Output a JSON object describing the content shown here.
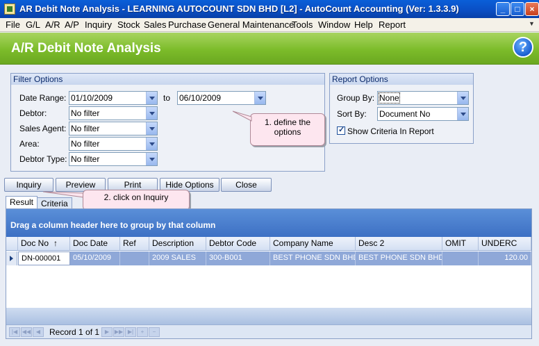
{
  "window": {
    "title": "AR Debit Note Analysis - LEARNING AUTOCOUNT SDN BHD [L2] - AutoCount Accounting (Ver: 1.3.3.9)",
    "minimize": "_",
    "maximize": "□",
    "close": "×"
  },
  "menu": [
    "File",
    "G/L",
    "A/R",
    "A/P",
    "Inquiry",
    "Stock",
    "Sales",
    "Purchase",
    "General Maintenance",
    "Tools",
    "Window",
    "Help",
    "Report"
  ],
  "header": {
    "title": "A/R Debit Note Analysis",
    "help": "?"
  },
  "filter": {
    "title": "Filter Options",
    "date_range_label": "Date Range:",
    "date_from": "01/10/2009",
    "to_label": "to",
    "date_to": "06/10/2009",
    "debtor_label": "Debtor:",
    "debtor_value": "No filter",
    "agent_label": "Sales Agent:",
    "agent_value": "No filter",
    "area_label": "Area:",
    "area_value": "No filter",
    "type_label": "Debtor Type:",
    "type_value": "No filter"
  },
  "report": {
    "title": "Report Options",
    "group_label": "Group By:",
    "group_value": "None",
    "sort_label": "Sort By:",
    "sort_value": "Document No",
    "criteria_label": "Show Criteria In Report"
  },
  "callouts": {
    "define_line1": "1. define the",
    "define_line2": "options",
    "inquiry": "2. click on Inquiry"
  },
  "buttons": {
    "inquiry": "Inquiry",
    "preview": "Preview",
    "print": "Print",
    "hide_options": "Hide Options",
    "close": "Close"
  },
  "tabs": {
    "result": "Result",
    "criteria": "Criteria"
  },
  "grid": {
    "group_panel": "Drag a column header here to group by that column",
    "columns": [
      "Doc No",
      "Doc Date",
      "Ref",
      "Description",
      "Debtor Code",
      "Company Name",
      "Desc 2",
      "OMIT",
      "UNDERC"
    ],
    "sort_icon": "↑",
    "row": [
      "DN-000001",
      "05/10/2009",
      "",
      "2009 SALES",
      "300-B001",
      "BEST PHONE SDN BHD",
      "BEST PHONE SDN BHD",
      "",
      "120.00"
    ],
    "record": "Record 1 of 1"
  }
}
